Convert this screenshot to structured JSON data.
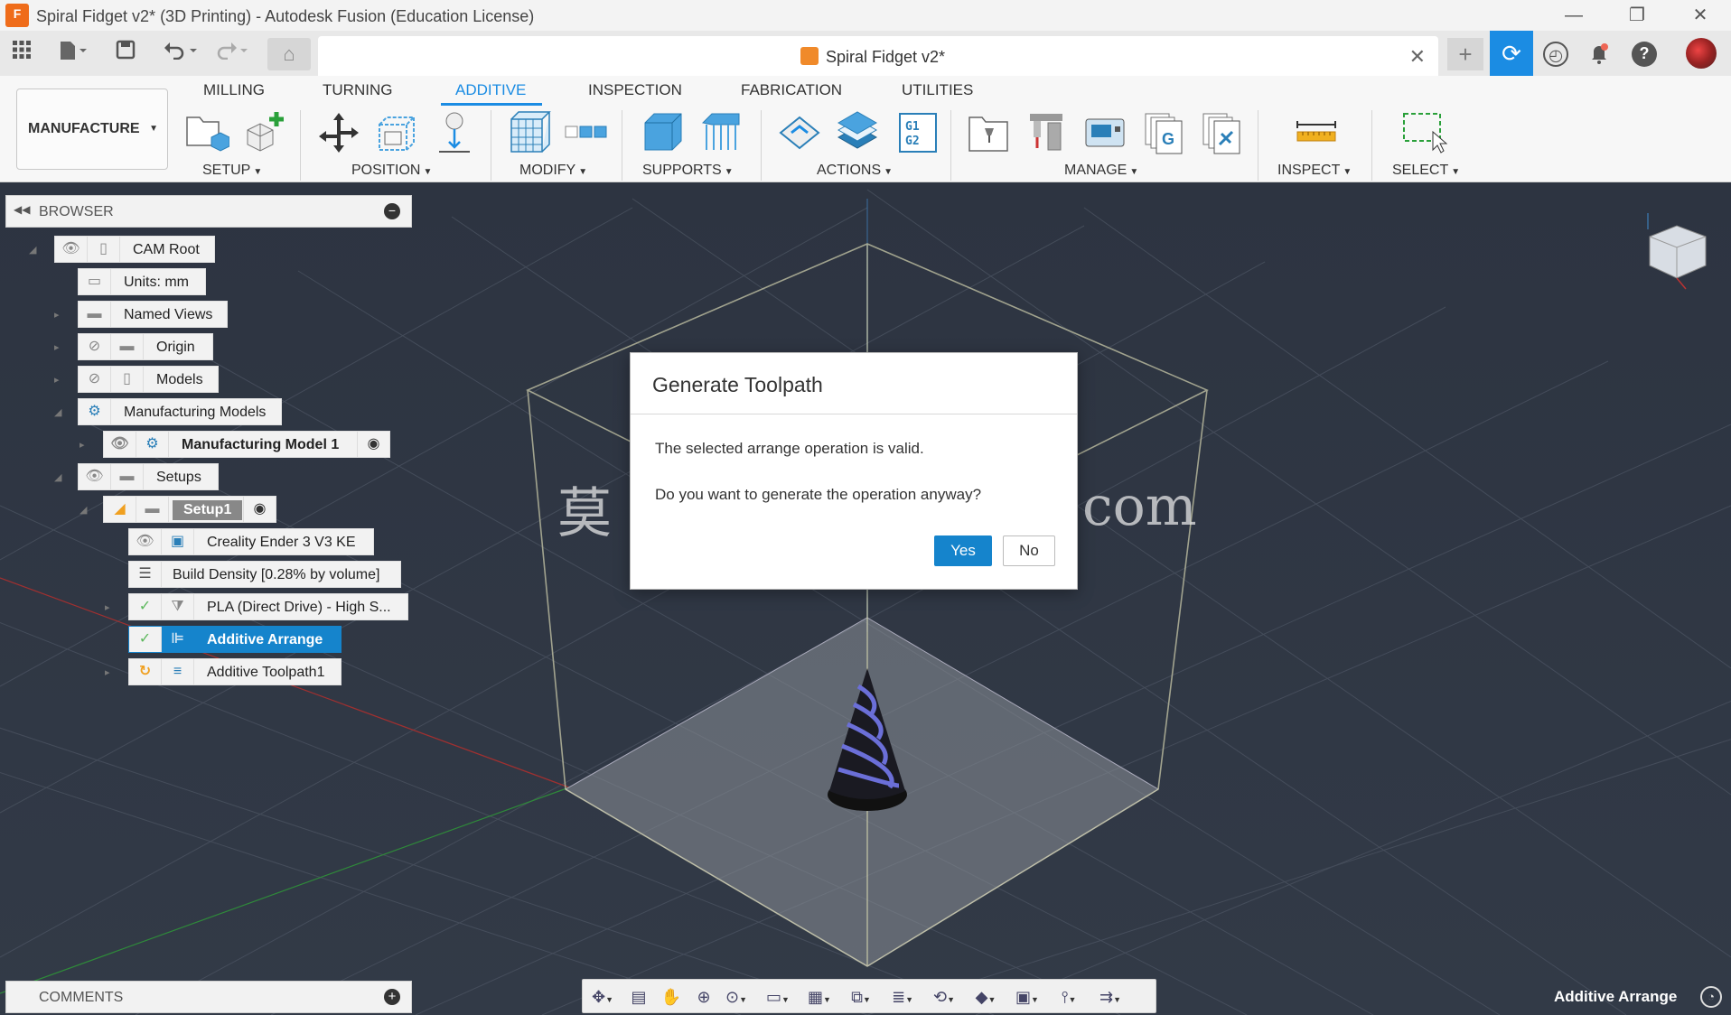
{
  "window": {
    "title": "Spiral Fidget v2* (3D Printing) - Autodesk Fusion (Education License)",
    "app_icon_letter": "F",
    "minimize": "—",
    "restore": "❐",
    "close": "✕"
  },
  "tabbar": {
    "document_tab_title": "Spiral Fidget v2*",
    "close_tab": "✕",
    "new_tab": "+"
  },
  "ribbon": {
    "workspace": "MANUFACTURE",
    "tabs": [
      "MILLING",
      "TURNING",
      "ADDITIVE",
      "INSPECTION",
      "FABRICATION",
      "UTILITIES"
    ],
    "active_tab": "ADDITIVE",
    "groups": [
      "SETUP",
      "POSITION",
      "MODIFY",
      "SUPPORTS",
      "ACTIONS",
      "MANAGE",
      "INSPECT",
      "SELECT"
    ]
  },
  "browser": {
    "title": "BROWSER",
    "items": [
      {
        "label": "CAM Root"
      },
      {
        "label": "Units: mm"
      },
      {
        "label": "Named Views"
      },
      {
        "label": "Origin"
      },
      {
        "label": "Models"
      },
      {
        "label": "Manufacturing Models"
      },
      {
        "label": "Manufacturing Model 1"
      },
      {
        "label": "Setups"
      },
      {
        "label": "Setup1"
      },
      {
        "label": "Creality Ender 3 V3 KE"
      },
      {
        "label": "Build Density [0.28% by volume]"
      },
      {
        "label": "PLA (Direct Drive) - High S..."
      },
      {
        "label": "Additive Arrange"
      },
      {
        "label": "Additive Toolpath1"
      }
    ],
    "selected": "Additive Arrange"
  },
  "dialog": {
    "title": "Generate Toolpath",
    "line1": "The selected arrange operation is valid.",
    "line2": "Do you want to generate the operation anyway?",
    "yes": "Yes",
    "no": "No"
  },
  "watermark": {
    "left": "莫",
    "right": "com"
  },
  "comments": {
    "title": "COMMENTS"
  },
  "status": {
    "active_operation": "Additive Arrange"
  },
  "colors": {
    "accent": "#1b8ce3",
    "selection": "#1584cc",
    "viewport_bg": "#2e3542",
    "status_ok": "#5cb85c",
    "status_pending": "#f0a020"
  }
}
